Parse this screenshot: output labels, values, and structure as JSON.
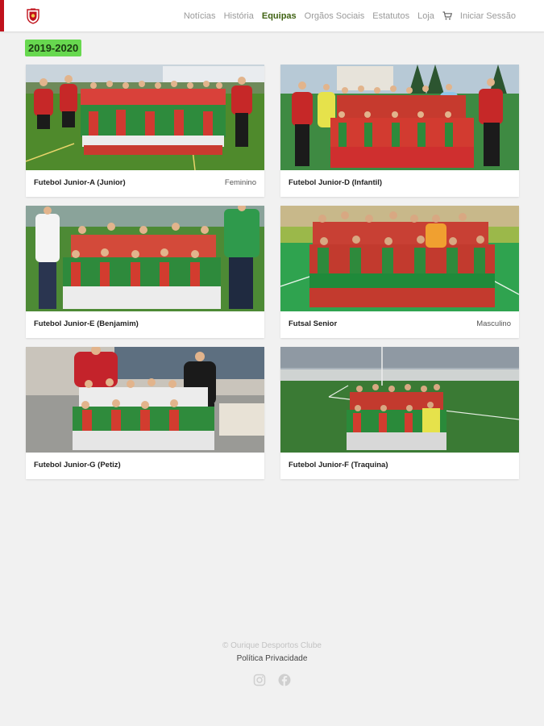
{
  "nav": {
    "links": [
      {
        "label": "Notícias"
      },
      {
        "label": "História"
      },
      {
        "label": "Equipas"
      },
      {
        "label": "Orgãos Sociais"
      },
      {
        "label": "Estatutos"
      },
      {
        "label": "Loja"
      }
    ],
    "login_label": "Iniciar Sessão",
    "logo_icon": "club-crest-icon",
    "cart_icon": "shopping-cart-icon"
  },
  "season": "2019-2020",
  "teams": [
    {
      "title": "Futebol Junior-A (Junior)",
      "tag": "Feminino"
    },
    {
      "title": "Futebol Junior-D (Infantil)",
      "tag": ""
    },
    {
      "title": "Futebol Junior-E (Benjamim)",
      "tag": ""
    },
    {
      "title": "Futsal Senior",
      "tag": "Masculino"
    },
    {
      "title": "Futebol Junior-G (Petiz)",
      "tag": ""
    },
    {
      "title": "Futebol Junior-F (Traquina)",
      "tag": ""
    }
  ],
  "footer": {
    "copyright": "© Ourique Desportos Clube",
    "privacy": "Política Privacidade",
    "social_icons": [
      "instagram-icon",
      "facebook-icon"
    ]
  },
  "colors": {
    "accent_red": "#c0121c",
    "season_badge": "#67d84f",
    "active_nav": "#3f6212",
    "background": "#f1f1f1"
  }
}
